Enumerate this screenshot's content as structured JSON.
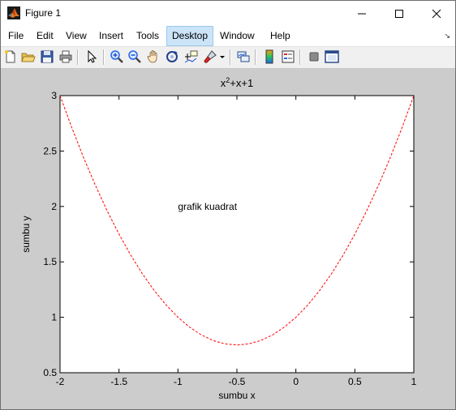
{
  "window": {
    "title": "Figure 1",
    "controls": {
      "minimize": "minimize",
      "maximize": "maximize",
      "close": "close"
    }
  },
  "menu": {
    "items": [
      "File",
      "Edit",
      "View",
      "Insert",
      "Tools",
      "Desktop",
      "Window",
      "Help"
    ],
    "active": "Desktop"
  },
  "toolbar": {
    "icons": [
      "new-figure-icon",
      "open-file-icon",
      "save-icon",
      "print-icon",
      "pointer-icon",
      "zoom-in-icon",
      "zoom-out-icon",
      "pan-icon",
      "rotate-3d-icon",
      "data-cursor-icon",
      "brush-icon",
      "dropdown-arrow-icon",
      "link-plot-icon",
      "colorbar-icon",
      "legend-icon",
      "hide-plot-tools-icon",
      "show-plot-tools-icon"
    ]
  },
  "colors": {
    "curve": "#ff0000",
    "figure_bg": "#cccccc",
    "axes_bg": "#ffffff"
  },
  "chart_data": {
    "type": "line",
    "title_base": "x",
    "title_superscript": "2",
    "title_rest": "+x+1",
    "xlabel": "sumbu x",
    "ylabel": "sumbu y",
    "xlim": [
      -2,
      1
    ],
    "ylim": [
      0.5,
      3
    ],
    "xticks": [
      -2,
      -1.5,
      -1,
      -0.5,
      0,
      0.5,
      1
    ],
    "yticks": [
      0.5,
      1,
      1.5,
      2,
      2.5,
      3
    ],
    "xtick_labels": [
      "-2",
      "-1.5",
      "-1",
      "-0.5",
      "0",
      "0.5",
      "1"
    ],
    "ytick_labels": [
      "0.5",
      "1",
      "1.5",
      "2",
      "2.5",
      "3"
    ],
    "annotation": {
      "text": "grafik kuadrat",
      "x": -1,
      "y": 2
    },
    "line_style": "dashed",
    "grid": false,
    "series": [
      {
        "x": [
          -2,
          -1.9,
          -1.8,
          -1.7,
          -1.6,
          -1.5,
          -1.4,
          -1.3,
          -1.2,
          -1.1,
          -1,
          -0.9,
          -0.8,
          -0.7,
          -0.6,
          -0.5,
          -0.4,
          -0.3,
          -0.2,
          -0.1,
          0,
          0.1,
          0.2,
          0.3,
          0.4,
          0.5,
          0.6,
          0.7,
          0.8,
          0.9,
          1
        ],
        "values": [
          3,
          2.71,
          2.44,
          2.19,
          1.96,
          1.75,
          1.56,
          1.39,
          1.24,
          1.11,
          1,
          0.91,
          0.84,
          0.79,
          0.76,
          0.75,
          0.76,
          0.79,
          0.84,
          0.91,
          1,
          1.11,
          1.24,
          1.39,
          1.56,
          1.75,
          1.96,
          2.19,
          2.44,
          2.71,
          3
        ]
      }
    ]
  }
}
